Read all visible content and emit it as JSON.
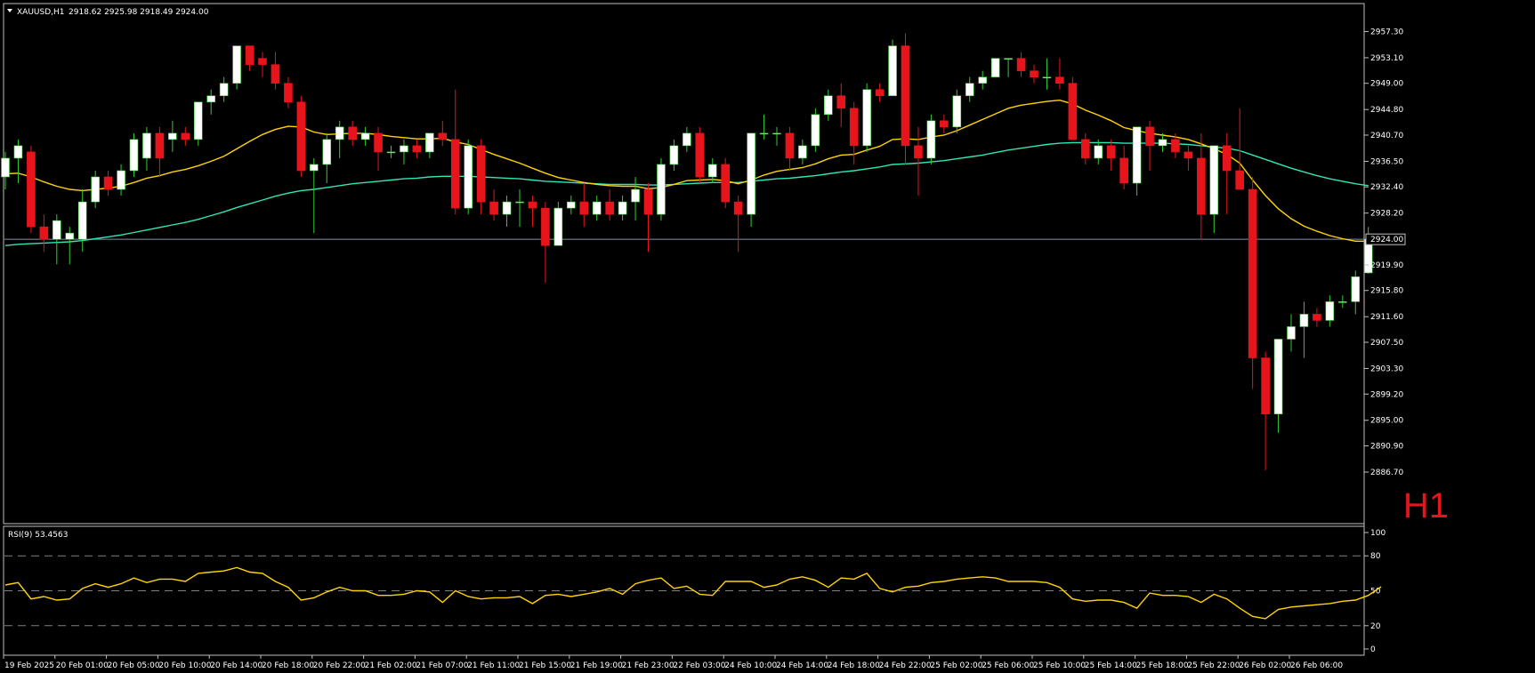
{
  "header": {
    "symbol": "XAUUSD,H1",
    "ohlc": "2918.62 2925.98 2918.49 2924.00"
  },
  "timeframe_label": "H1",
  "colors": {
    "background": "#000000",
    "frame": "#c0c0c0",
    "bull_body": "#ffffff",
    "bear_body": "#e8141c",
    "wick_bull": "#32cd32",
    "wick_bear": "#e8141c",
    "ma_fast": "#ffd400",
    "ma_slow": "#2ee6b6",
    "price_line": "#7f8fa6",
    "rsi_line": "#ffd400",
    "rsi_levels": "#808080"
  },
  "chart_data": [
    {
      "type": "candlestick",
      "title": "XAUUSD,H1",
      "ylim": [
        2886.7,
        2959.5
      ],
      "y_ticks": [
        "2957.30",
        "2953.10",
        "2949.00",
        "2944.80",
        "2940.70",
        "2936.50",
        "2932.40",
        "2928.20",
        "2924.00",
        "2919.90",
        "2915.80",
        "2911.60",
        "2907.50",
        "2903.30",
        "2899.20",
        "2895.00",
        "2890.90",
        "2886.70"
      ],
      "current_price": "2924.00",
      "x_ticks": [
        "19 Feb 2025",
        "20 Feb 01:00",
        "20 Feb 05:00",
        "20 Feb 10:00",
        "20 Feb 14:00",
        "20 Feb 18:00",
        "20 Feb 22:00",
        "21 Feb 02:00",
        "21 Feb 07:00",
        "21 Feb 11:00",
        "21 Feb 15:00",
        "21 Feb 19:00",
        "21 Feb 23:00",
        "22 Feb 03:00",
        "24 Feb 10:00",
        "24 Feb 14:00",
        "24 Feb 18:00",
        "24 Feb 22:00",
        "25 Feb 02:00",
        "25 Feb 06:00",
        "25 Feb 10:00",
        "25 Feb 14:00",
        "25 Feb 18:00",
        "25 Feb 22:00",
        "26 Feb 02:00",
        "26 Feb 06:00"
      ],
      "candles": [
        {
          "o": 2934,
          "h": 2938,
          "l": 2932,
          "c": 2937
        },
        {
          "o": 2937,
          "h": 2940,
          "l": 2933,
          "c": 2939
        },
        {
          "o": 2938,
          "h": 2939,
          "l": 2925,
          "c": 2926
        },
        {
          "o": 2926,
          "h": 2928,
          "l": 2922,
          "c": 2924
        },
        {
          "o": 2924,
          "h": 2928,
          "l": 2920,
          "c": 2927
        },
        {
          "o": 2924,
          "h": 2926,
          "l": 2920,
          "c": 2925
        },
        {
          "o": 2924,
          "h": 2932,
          "l": 2922,
          "c": 2930
        },
        {
          "o": 2930,
          "h": 2935,
          "l": 2929,
          "c": 2934
        },
        {
          "o": 2934,
          "h": 2935,
          "l": 2931,
          "c": 2932
        },
        {
          "o": 2932,
          "h": 2936,
          "l": 2931,
          "c": 2935
        },
        {
          "o": 2935,
          "h": 2941,
          "l": 2934,
          "c": 2940
        },
        {
          "o": 2937,
          "h": 2942,
          "l": 2935,
          "c": 2941
        },
        {
          "o": 2941,
          "h": 2942,
          "l": 2934,
          "c": 2937
        },
        {
          "o": 2940,
          "h": 2943,
          "l": 2938,
          "c": 2941
        },
        {
          "o": 2941,
          "h": 2942,
          "l": 2939,
          "c": 2940
        },
        {
          "o": 2940,
          "h": 2946,
          "l": 2939,
          "c": 2946
        },
        {
          "o": 2946,
          "h": 2948,
          "l": 2944,
          "c": 2947
        },
        {
          "o": 2947,
          "h": 2950,
          "l": 2946,
          "c": 2949
        },
        {
          "o": 2949,
          "h": 2955,
          "l": 2948,
          "c": 2955
        },
        {
          "o": 2955,
          "h": 2955,
          "l": 2951,
          "c": 2952
        },
        {
          "o": 2953,
          "h": 2954,
          "l": 2950,
          "c": 2952
        },
        {
          "o": 2952,
          "h": 2954,
          "l": 2948,
          "c": 2949
        },
        {
          "o": 2949,
          "h": 2950,
          "l": 2945,
          "c": 2946
        },
        {
          "o": 2946,
          "h": 2947,
          "l": 2934,
          "c": 2935
        },
        {
          "o": 2935,
          "h": 2937,
          "l": 2925,
          "c": 2936
        },
        {
          "o": 2936,
          "h": 2941,
          "l": 2933,
          "c": 2940
        },
        {
          "o": 2940,
          "h": 2943,
          "l": 2937,
          "c": 2942
        },
        {
          "o": 2942,
          "h": 2943,
          "l": 2939,
          "c": 2940
        },
        {
          "o": 2940,
          "h": 2942,
          "l": 2939,
          "c": 2941
        },
        {
          "o": 2941,
          "h": 2942,
          "l": 2935,
          "c": 2938
        },
        {
          "o": 2938,
          "h": 2939,
          "l": 2937,
          "c": 2938
        },
        {
          "o": 2938,
          "h": 2940,
          "l": 2936,
          "c": 2939
        },
        {
          "o": 2939,
          "h": 2940,
          "l": 2937,
          "c": 2938
        },
        {
          "o": 2938,
          "h": 2941,
          "l": 2937,
          "c": 2941
        },
        {
          "o": 2941,
          "h": 2943,
          "l": 2939,
          "c": 2940
        },
        {
          "o": 2940,
          "h": 2948,
          "l": 2928,
          "c": 2929
        },
        {
          "o": 2929,
          "h": 2940,
          "l": 2928,
          "c": 2939
        },
        {
          "o": 2939,
          "h": 2940,
          "l": 2928,
          "c": 2930
        },
        {
          "o": 2930,
          "h": 2932,
          "l": 2927,
          "c": 2928
        },
        {
          "o": 2928,
          "h": 2931,
          "l": 2926,
          "c": 2930
        },
        {
          "o": 2930,
          "h": 2932,
          "l": 2926,
          "c": 2930
        },
        {
          "o": 2930,
          "h": 2931,
          "l": 2926,
          "c": 2929
        },
        {
          "o": 2929,
          "h": 2930,
          "l": 2917,
          "c": 2923
        },
        {
          "o": 2923,
          "h": 2930,
          "l": 2923,
          "c": 2929
        },
        {
          "o": 2929,
          "h": 2931,
          "l": 2928,
          "c": 2930
        },
        {
          "o": 2930,
          "h": 2933,
          "l": 2926,
          "c": 2928
        },
        {
          "o": 2928,
          "h": 2931,
          "l": 2927,
          "c": 2930
        },
        {
          "o": 2930,
          "h": 2932,
          "l": 2927,
          "c": 2928
        },
        {
          "o": 2928,
          "h": 2931,
          "l": 2927,
          "c": 2930
        },
        {
          "o": 2930,
          "h": 2934,
          "l": 2927,
          "c": 2932
        },
        {
          "o": 2932,
          "h": 2933,
          "l": 2922,
          "c": 2928
        },
        {
          "o": 2928,
          "h": 2937,
          "l": 2927,
          "c": 2936
        },
        {
          "o": 2936,
          "h": 2940,
          "l": 2935,
          "c": 2939
        },
        {
          "o": 2939,
          "h": 2942,
          "l": 2938,
          "c": 2941
        },
        {
          "o": 2941,
          "h": 2942,
          "l": 2933,
          "c": 2934
        },
        {
          "o": 2934,
          "h": 2937,
          "l": 2933,
          "c": 2936
        },
        {
          "o": 2936,
          "h": 2937,
          "l": 2929,
          "c": 2930
        },
        {
          "o": 2930,
          "h": 2931,
          "l": 2922,
          "c": 2928
        },
        {
          "o": 2928,
          "h": 2941,
          "l": 2926,
          "c": 2941
        },
        {
          "o": 2941,
          "h": 2944,
          "l": 2940,
          "c": 2941
        },
        {
          "o": 2941,
          "h": 2942,
          "l": 2939,
          "c": 2941
        },
        {
          "o": 2941,
          "h": 2942,
          "l": 2935,
          "c": 2937
        },
        {
          "o": 2937,
          "h": 2940,
          "l": 2936,
          "c": 2939
        },
        {
          "o": 2939,
          "h": 2945,
          "l": 2938,
          "c": 2944
        },
        {
          "o": 2944,
          "h": 2948,
          "l": 2943,
          "c": 2947
        },
        {
          "o": 2947,
          "h": 2949,
          "l": 2942,
          "c": 2945
        },
        {
          "o": 2945,
          "h": 2946,
          "l": 2936,
          "c": 2939
        },
        {
          "o": 2939,
          "h": 2949,
          "l": 2938,
          "c": 2948
        },
        {
          "o": 2948,
          "h": 2949,
          "l": 2946,
          "c": 2947
        },
        {
          "o": 2947,
          "h": 2956,
          "l": 2947,
          "c": 2955
        },
        {
          "o": 2955,
          "h": 2957,
          "l": 2936,
          "c": 2939
        },
        {
          "o": 2939,
          "h": 2942,
          "l": 2931,
          "c": 2937
        },
        {
          "o": 2937,
          "h": 2944,
          "l": 2936,
          "c": 2943
        },
        {
          "o": 2943,
          "h": 2944,
          "l": 2941,
          "c": 2942
        },
        {
          "o": 2942,
          "h": 2948,
          "l": 2941,
          "c": 2947
        },
        {
          "o": 2947,
          "h": 2950,
          "l": 2946,
          "c": 2949
        },
        {
          "o": 2949,
          "h": 2951,
          "l": 2948,
          "c": 2950
        },
        {
          "o": 2950,
          "h": 2953,
          "l": 2950,
          "c": 2953
        },
        {
          "o": 2953,
          "h": 2953,
          "l": 2950,
          "c": 2953
        },
        {
          "o": 2953,
          "h": 2954,
          "l": 2950,
          "c": 2951
        },
        {
          "o": 2951,
          "h": 2952,
          "l": 2949,
          "c": 2950
        },
        {
          "o": 2950,
          "h": 2953,
          "l": 2948,
          "c": 2950
        },
        {
          "o": 2950,
          "h": 2953,
          "l": 2948,
          "c": 2949
        },
        {
          "o": 2949,
          "h": 2950,
          "l": 2940,
          "c": 2940
        },
        {
          "o": 2940,
          "h": 2941,
          "l": 2936,
          "c": 2937
        },
        {
          "o": 2937,
          "h": 2940,
          "l": 2936,
          "c": 2939
        },
        {
          "o": 2939,
          "h": 2940,
          "l": 2935,
          "c": 2937
        },
        {
          "o": 2937,
          "h": 2939,
          "l": 2932,
          "c": 2933
        },
        {
          "o": 2933,
          "h": 2939,
          "l": 2931,
          "c": 2942
        },
        {
          "o": 2942,
          "h": 2943,
          "l": 2935,
          "c": 2939
        },
        {
          "o": 2939,
          "h": 2941,
          "l": 2938,
          "c": 2940
        },
        {
          "o": 2940,
          "h": 2941,
          "l": 2937,
          "c": 2938
        },
        {
          "o": 2938,
          "h": 2939,
          "l": 2935,
          "c": 2937
        },
        {
          "o": 2937,
          "h": 2941,
          "l": 2924,
          "c": 2928
        },
        {
          "o": 2928,
          "h": 2938,
          "l": 2925,
          "c": 2939
        },
        {
          "o": 2939,
          "h": 2941,
          "l": 2928,
          "c": 2935
        },
        {
          "o": 2935,
          "h": 2945,
          "l": 2934,
          "c": 2932
        },
        {
          "o": 2932,
          "h": 2934,
          "l": 2900,
          "c": 2905
        },
        {
          "o": 2905,
          "h": 2906,
          "l": 2887,
          "c": 2896
        },
        {
          "o": 2896,
          "h": 2908,
          "l": 2893,
          "c": 2908
        },
        {
          "o": 2908,
          "h": 2912,
          "l": 2906,
          "c": 2910
        },
        {
          "o": 2910,
          "h": 2914,
          "l": 2905,
          "c": 2912
        },
        {
          "o": 2912,
          "h": 2913,
          "l": 2910,
          "c": 2911
        },
        {
          "o": 2911,
          "h": 2915,
          "l": 2910,
          "c": 2914
        },
        {
          "o": 2914,
          "h": 2915,
          "l": 2913,
          "c": 2914
        },
        {
          "o": 2914,
          "h": 2919,
          "l": 2912,
          "c": 2918
        },
        {
          "o": 2918.62,
          "h": 2925.98,
          "l": 2918.49,
          "c": 2924.0
        }
      ],
      "ma_fast": [
        2934.5,
        2934.6,
        2934.0,
        2933.2,
        2932.5,
        2932.0,
        2931.8,
        2932.0,
        2932.2,
        2932.5,
        2933.1,
        2933.8,
        2934.2,
        2934.8,
        2935.2,
        2935.8,
        2936.5,
        2937.3,
        2938.5,
        2939.7,
        2940.8,
        2941.6,
        2942.1,
        2942.0,
        2941.2,
        2940.8,
        2940.9,
        2941.0,
        2941.0,
        2940.8,
        2940.5,
        2940.3,
        2940.1,
        2940.1,
        2940.2,
        2939.6,
        2939.2,
        2938.4,
        2937.6,
        2936.9,
        2936.2,
        2935.4,
        2934.6,
        2933.9,
        2933.5,
        2933.1,
        2932.8,
        2932.6,
        2932.5,
        2932.5,
        2932.1,
        2932.3,
        2932.8,
        2933.4,
        2933.5,
        2933.6,
        2933.4,
        2932.9,
        2933.5,
        2934.3,
        2934.9,
        2935.2,
        2935.5,
        2936.1,
        2936.9,
        2937.5,
        2937.6,
        2938.3,
        2938.9,
        2940.0,
        2940.1,
        2940.0,
        2940.4,
        2940.7,
        2941.4,
        2942.3,
        2943.2,
        2944.1,
        2945.0,
        2945.5,
        2945.8,
        2946.1,
        2946.3,
        2945.7,
        2944.7,
        2943.9,
        2943.0,
        2941.9,
        2941.4,
        2941.0,
        2940.7,
        2940.4,
        2940.0,
        2939.3,
        2938.5,
        2937.6,
        2936.2,
        2933.5,
        2931.0,
        2928.9,
        2927.3,
        2926.1,
        2925.3,
        2924.6,
        2924.1,
        2923.7,
        2923.7
      ],
      "ma_slow": [
        2923.0,
        2923.2,
        2923.3,
        2923.4,
        2923.5,
        2923.6,
        2923.8,
        2924.1,
        2924.4,
        2924.7,
        2925.1,
        2925.5,
        2925.9,
        2926.3,
        2926.7,
        2927.2,
        2927.8,
        2928.4,
        2929.1,
        2929.7,
        2930.3,
        2930.9,
        2931.4,
        2931.8,
        2932.0,
        2932.3,
        2932.6,
        2932.9,
        2933.1,
        2933.3,
        2933.5,
        2933.7,
        2933.8,
        2934.0,
        2934.1,
        2934.1,
        2934.1,
        2934.0,
        2933.9,
        2933.8,
        2933.7,
        2933.5,
        2933.3,
        2933.2,
        2933.1,
        2933.0,
        2932.9,
        2932.8,
        2932.8,
        2932.8,
        2932.7,
        2932.7,
        2932.8,
        2932.9,
        2933.0,
        2933.1,
        2933.1,
        2933.1,
        2933.3,
        2933.5,
        2933.7,
        2933.8,
        2934.0,
        2934.2,
        2934.5,
        2934.8,
        2935.0,
        2935.3,
        2935.6,
        2936.0,
        2936.1,
        2936.2,
        2936.4,
        2936.6,
        2936.9,
        2937.2,
        2937.5,
        2937.9,
        2938.3,
        2938.6,
        2938.9,
        2939.2,
        2939.4,
        2939.5,
        2939.5,
        2939.5,
        2939.5,
        2939.4,
        2939.4,
        2939.4,
        2939.4,
        2939.3,
        2939.2,
        2939.0,
        2938.8,
        2938.6,
        2938.2,
        2937.5,
        2936.8,
        2936.1,
        2935.4,
        2934.8,
        2934.2,
        2933.7,
        2933.3,
        2932.9,
        2932.6
      ]
    },
    {
      "type": "line",
      "title": "RSI(9) 53.4563",
      "ylim": [
        0,
        100
      ],
      "y_ticks": [
        "100",
        "80",
        "50",
        "20",
        "0"
      ],
      "levels": [
        80,
        50,
        20
      ],
      "values": [
        55,
        57,
        43,
        45,
        42,
        43,
        52,
        56,
        53,
        56,
        61,
        57,
        60,
        60,
        58,
        65,
        66,
        67,
        70,
        66,
        65,
        58,
        53,
        42,
        44,
        49,
        53,
        50,
        50,
        46,
        46,
        47,
        50,
        49,
        40,
        50,
        45,
        43,
        44,
        44,
        45,
        39,
        46,
        47,
        45,
        47,
        49,
        52,
        47,
        56,
        59,
        61,
        52,
        54,
        47,
        46,
        58,
        58,
        58,
        53,
        55,
        60,
        62,
        59,
        53,
        61,
        60,
        65,
        52,
        49,
        53,
        54,
        57,
        58,
        60,
        61,
        62,
        61,
        58,
        58,
        58,
        57,
        53,
        43,
        41,
        42,
        42,
        40,
        35,
        48,
        46,
        46,
        45,
        40,
        47,
        43,
        35,
        28,
        26,
        34,
        36,
        37,
        38,
        39,
        41,
        42,
        46,
        53.4563
      ]
    }
  ]
}
